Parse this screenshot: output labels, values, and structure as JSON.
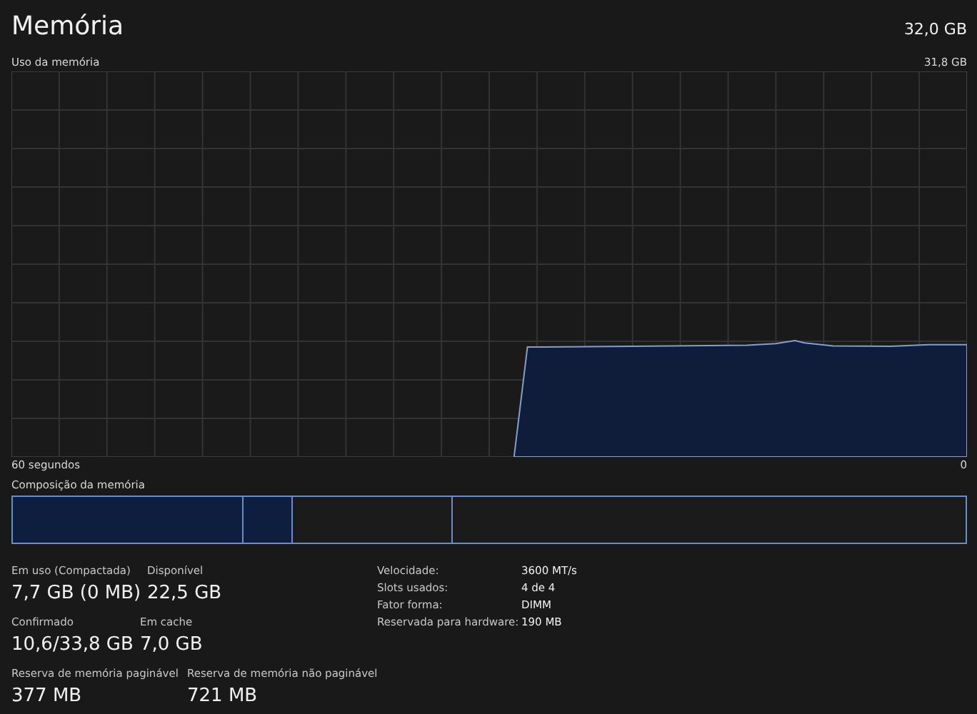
{
  "header": {
    "title": "Memória",
    "total": "32,0 GB"
  },
  "usage_graph": {
    "label": "Uso da memória",
    "max": "31,8 GB",
    "x_start": "60 segundos",
    "x_end": "0"
  },
  "composition": {
    "label": "Composição da memória"
  },
  "stats": [
    [
      {
        "label": "Em uso (Compactada)",
        "value": "7,7 GB (0 MB)"
      },
      {
        "label": "Disponível",
        "value": "22,5 GB"
      }
    ],
    [
      {
        "label": "Confirmado",
        "value": "10,6/33,8 GB"
      },
      {
        "label": "Em cache",
        "value": "7,0 GB"
      }
    ],
    [
      {
        "label": "Reserva de memória paginável",
        "value": "377 MB"
      },
      {
        "label": "Reserva de memória não paginável",
        "value": "721 MB"
      }
    ]
  ],
  "details": [
    {
      "label": "Velocidade:",
      "value": "3600 MT/s"
    },
    {
      "label": "Slots usados:",
      "value": "4 de 4"
    },
    {
      "label": "Fator forma:",
      "value": "DIMM"
    },
    {
      "label": "Reservada para hardware:",
      "value": "190 MB"
    }
  ]
}
